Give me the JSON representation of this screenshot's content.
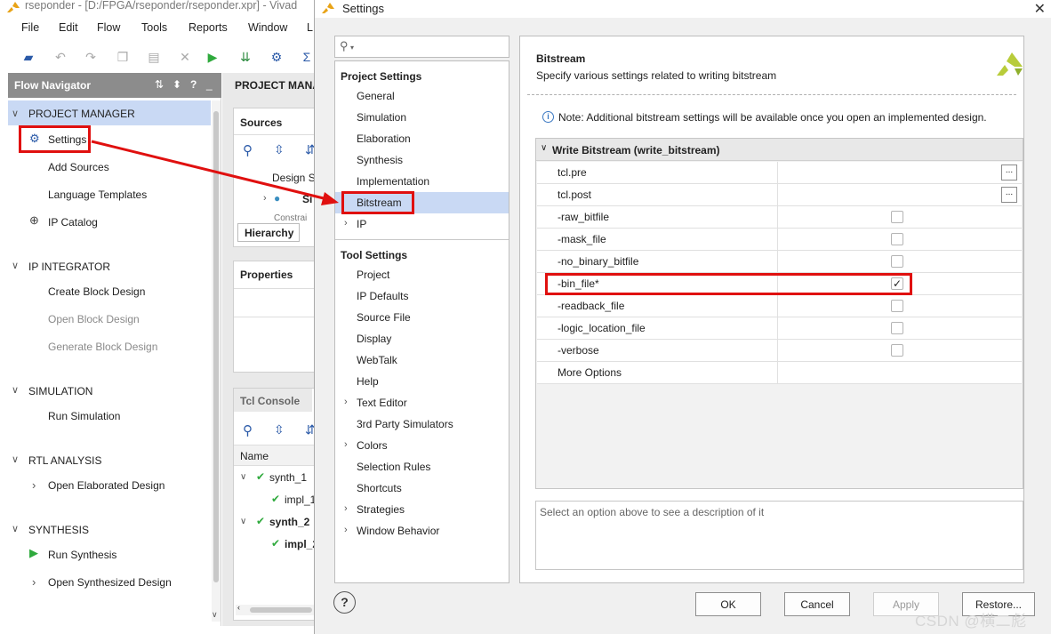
{
  "main_window": {
    "title": "rseponder - [D:/FPGA/rseponder/rseponder.xpr] - Vivad",
    "menu": [
      "File",
      "Edit",
      "Flow",
      "Tools",
      "Reports",
      "Window",
      "L"
    ],
    "flow_navigator": {
      "title": "Flow Navigator",
      "sections": {
        "project_manager": {
          "label": "PROJECT MANAGER",
          "items": [
            "Settings",
            "Add Sources",
            "Language Templates",
            "IP Catalog"
          ]
        },
        "ip_integrator": {
          "label": "IP INTEGRATOR",
          "items": [
            "Create Block Design",
            "Open Block Design",
            "Generate Block Design"
          ]
        },
        "simulation": {
          "label": "SIMULATION",
          "items": [
            "Run Simulation"
          ]
        },
        "rtl_analysis": {
          "label": "RTL ANALYSIS",
          "items": [
            "Open Elaborated Design"
          ]
        },
        "synthesis": {
          "label": "SYNTHESIS",
          "items": [
            "Run Synthesis",
            "Open Synthesized Design"
          ]
        }
      }
    },
    "project_manager_header": "PROJECT MANA",
    "sources": {
      "title": "Sources",
      "tree": [
        "Design S",
        "Si",
        "Constrai"
      ],
      "tab": "Hierarchy"
    },
    "properties": {
      "title": "Properties"
    },
    "tcl_console": {
      "title": "Tcl Console",
      "col_name": "Name",
      "runs": [
        "synth_1",
        "impl_1",
        "synth_2",
        "impl_2"
      ]
    }
  },
  "dialog": {
    "title": "Settings",
    "search_placeholder": "",
    "project_settings": {
      "label": "Project Settings",
      "items": [
        "General",
        "Simulation",
        "Elaboration",
        "Synthesis",
        "Implementation",
        "Bitstream",
        "IP"
      ]
    },
    "tool_settings": {
      "label": "Tool Settings",
      "items": [
        "Project",
        "IP Defaults",
        "Source File",
        "Display",
        "WebTalk",
        "Help",
        "Text Editor",
        "3rd Party Simulators",
        "Colors",
        "Selection Rules",
        "Shortcuts",
        "Strategies",
        "Window Behavior"
      ]
    },
    "selected_category": "Bitstream",
    "panel": {
      "title": "Bitstream",
      "subtitle": "Specify various settings related to writing bitstream",
      "note": "Note: Additional bitstream settings will be available once you open an implemented design.",
      "group_title": "Write Bitstream (write_bitstream)",
      "options": [
        {
          "name": "tcl.pre",
          "kind": "browse"
        },
        {
          "name": "tcl.post",
          "kind": "browse"
        },
        {
          "name": "-raw_bitfile",
          "kind": "checkbox",
          "checked": false
        },
        {
          "name": "-mask_file",
          "kind": "checkbox",
          "checked": false
        },
        {
          "name": "-no_binary_bitfile",
          "kind": "checkbox",
          "checked": false
        },
        {
          "name": "-bin_file*",
          "kind": "checkbox",
          "checked": true
        },
        {
          "name": "-readback_file",
          "kind": "checkbox",
          "checked": false
        },
        {
          "name": "-logic_location_file",
          "kind": "checkbox",
          "checked": false
        },
        {
          "name": "-verbose",
          "kind": "checkbox",
          "checked": false
        },
        {
          "name": "More Options",
          "kind": "text"
        }
      ],
      "description_placeholder": "Select an option above to see a description of it"
    },
    "buttons": {
      "ok": "OK",
      "cancel": "Cancel",
      "apply": "Apply",
      "restore": "Restore..."
    }
  },
  "browse_glyph": "...",
  "check_glyph": "✓",
  "watermark": "CSDN @横二彪",
  "colors": {
    "highlight_red": "#e0100f",
    "selection_blue": "#c9d9f4",
    "nav_header": "#8c8c8c",
    "run_green": "#2faa3d"
  }
}
